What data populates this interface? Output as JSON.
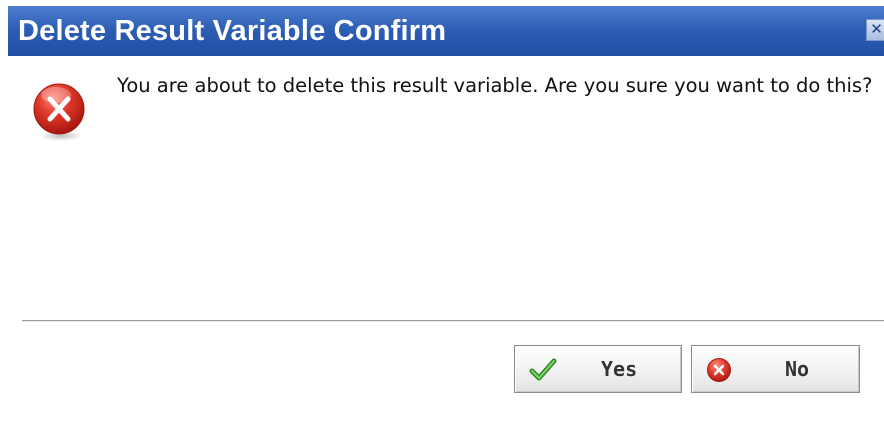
{
  "dialog": {
    "title": "Delete Result Variable Confirm",
    "close_glyph": "✕",
    "close_icon": "close-icon",
    "error_icon": "error-x-icon",
    "message": "You are about to delete this result variable. Are you sure you want to do this?"
  },
  "buttons": {
    "yes": {
      "label": "Yes",
      "icon": "checkmark-icon"
    },
    "no": {
      "label": "No",
      "icon": "cancel-x-icon"
    }
  },
  "colors": {
    "titlebar": "#2e5fb5",
    "title_text": "#ffffff",
    "error_red": "#d42a22",
    "check_green": "#3a9a2e"
  }
}
